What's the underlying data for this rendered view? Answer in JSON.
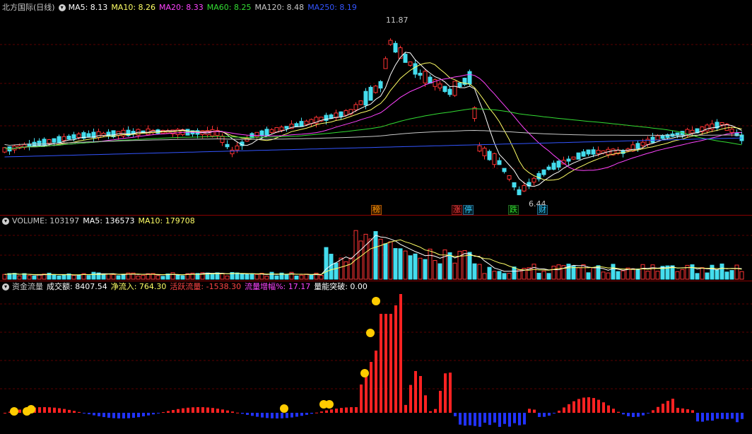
{
  "main": {
    "title": "北方国际(日线)",
    "ma": [
      {
        "label": "MA5: 8.13",
        "color": "#ffffff"
      },
      {
        "label": "MA10: 8.26",
        "color": "#ffff66"
      },
      {
        "label": "MA20: 8.33",
        "color": "#ff44ff"
      },
      {
        "label": "MA60: 8.25",
        "color": "#33dd33"
      },
      {
        "label": "MA120: 8.48",
        "color": "#c8c8c8"
      },
      {
        "label": "MA250: 8.19",
        "color": "#3355ff"
      }
    ],
    "high_label": "11.87",
    "low_label": "6.44",
    "markers": [
      {
        "text": "榜",
        "color": "#ff9900",
        "bg": "#5a2a00"
      },
      {
        "text": "涨",
        "color": "#ff4444",
        "bg": "#3a0000"
      },
      {
        "text": "停",
        "color": "#33ccff",
        "bg": "#002a3a"
      },
      {
        "text": "跌",
        "color": "#33dd33",
        "bg": "#002a00"
      },
      {
        "text": "财",
        "color": "#33ccff",
        "bg": "#00203a"
      }
    ]
  },
  "volume": {
    "title": "VOLUME: 103197",
    "ma5": "MA5: 136573",
    "ma10": "MA10: 179708",
    "colors": {
      "title": "#c8c8c8",
      "ma5": "#ffffff",
      "ma10": "#ffff66"
    }
  },
  "flow": {
    "title": "资金流量",
    "items": [
      {
        "label": "成交额: 8407.54",
        "color": "#ffffff"
      },
      {
        "label": "净流入: 764.30",
        "color": "#ffff66"
      },
      {
        "label": "活跃流量: -1538.30",
        "color": "#ff4444"
      },
      {
        "label": "流量增幅%: 17.17",
        "color": "#ff44ff"
      },
      {
        "label": "量能突破: 0.00",
        "color": "#ffffff"
      }
    ]
  }
}
